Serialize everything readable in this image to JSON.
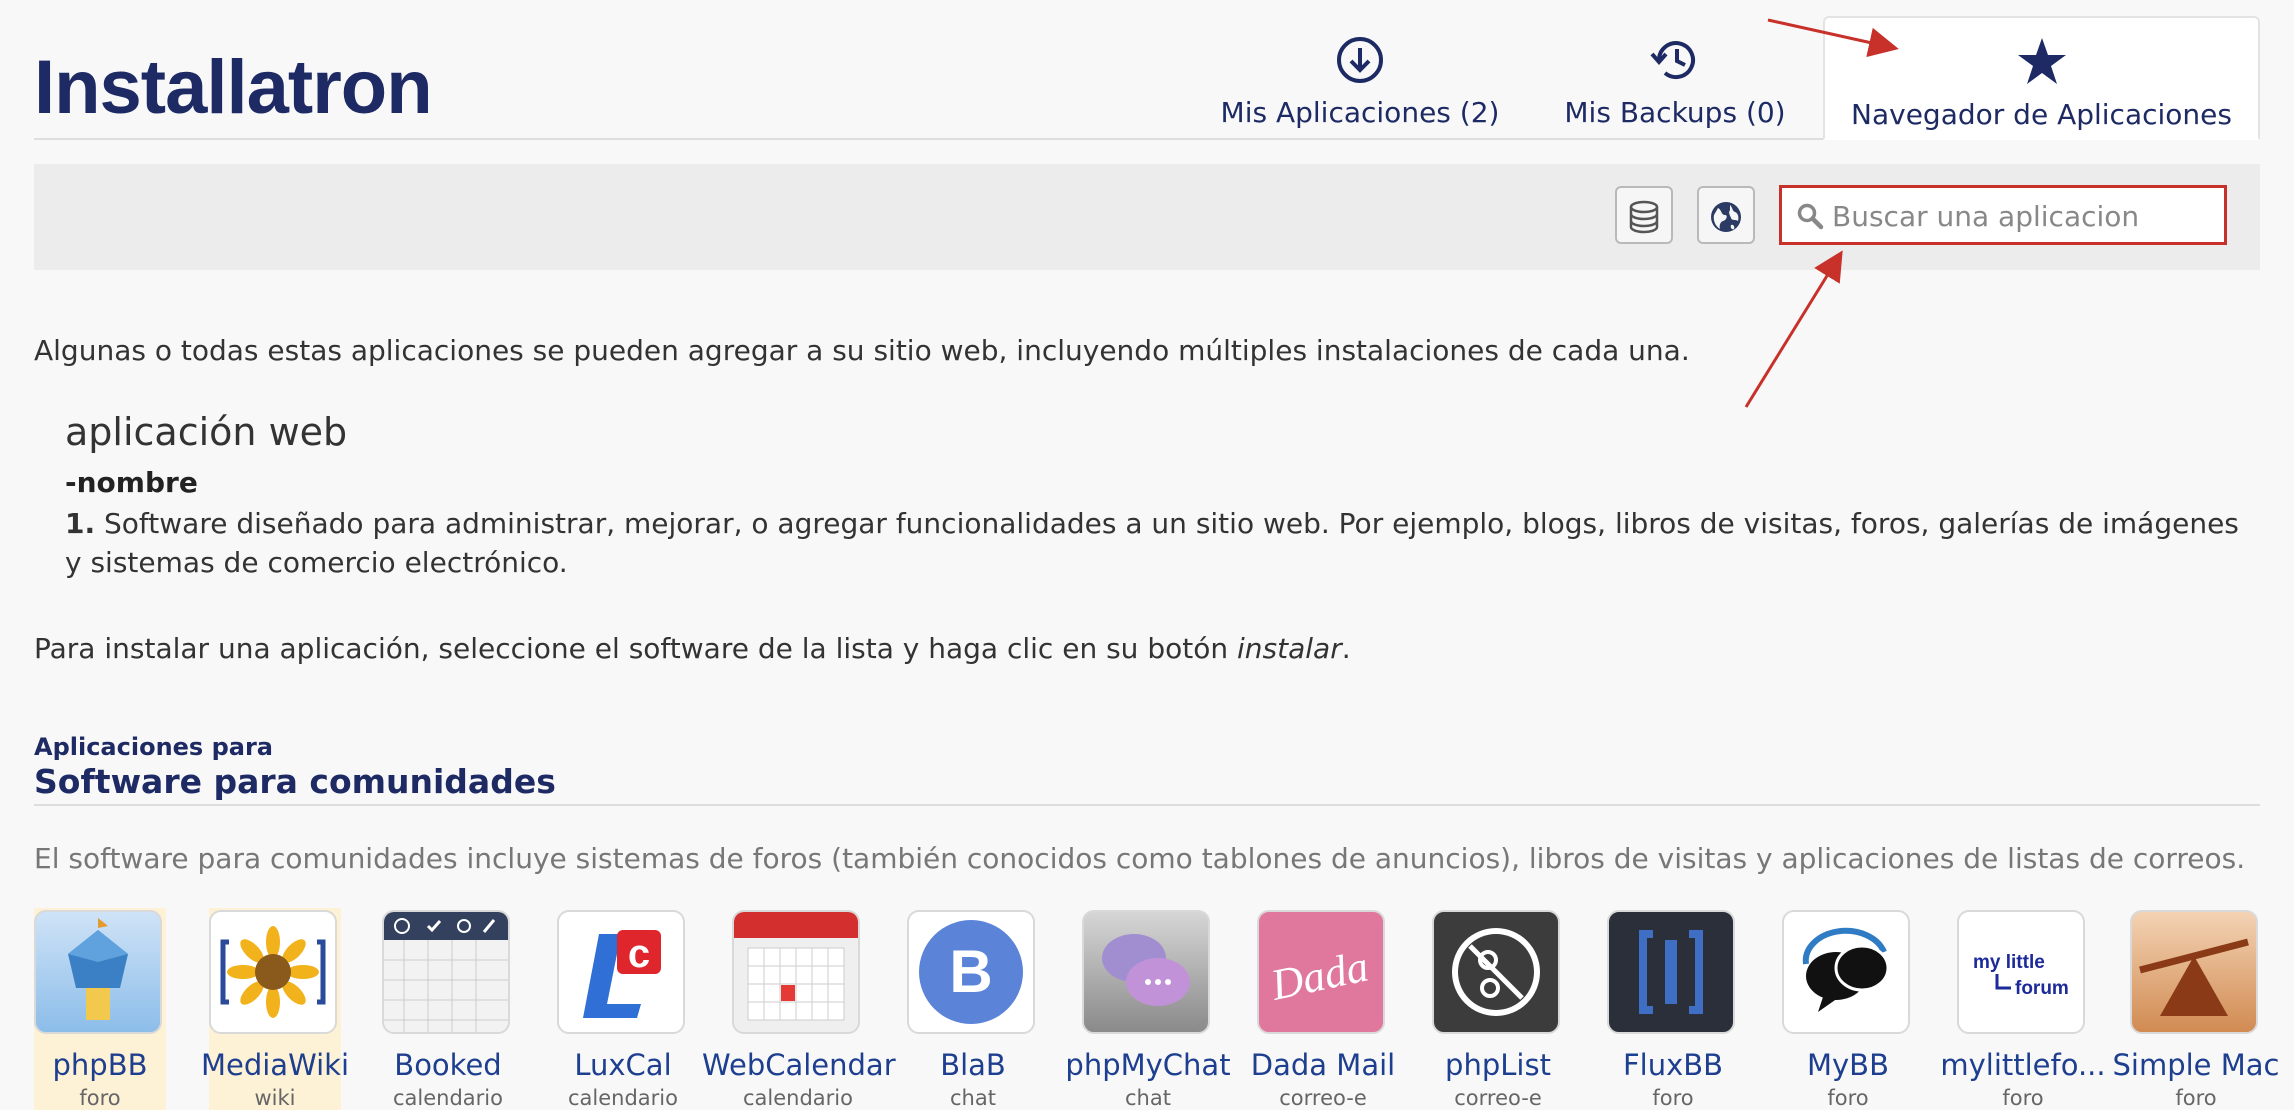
{
  "header": {
    "logo_text": "Installatron",
    "tabs": [
      {
        "label": "Mis Aplicaciones (2)",
        "icon": "download-circle-icon"
      },
      {
        "label": "Mis Backups (0)",
        "icon": "history-icon"
      },
      {
        "label": "Navegador de Aplicaciones",
        "icon": "star-icon"
      }
    ]
  },
  "toolbar": {
    "database_icon": "database-icon",
    "globe_icon": "globe-icon",
    "search_placeholder": "Buscar una aplicacion"
  },
  "intro": "Algunas o todas estas aplicaciones se pueden agregar a su sitio web, incluyendo múltiples instalaciones de cada una.",
  "definition": {
    "term": "aplicación web",
    "part": "-nombre",
    "number": "1.",
    "text": "Software diseñado para administrar, mejorar, o agregar funcionalidades a un sitio web. Por ejemplo, blogs, libros de visitas, foros, galerías de imágenes y sistemas de comercio electrónico."
  },
  "install_note": {
    "prefix": "Para instalar una aplicación, seleccione el software de la lista y haga clic en su botón ",
    "emphasis": "instalar",
    "suffix": "."
  },
  "section": {
    "small_title": "Aplicaciones para",
    "title": "Software para comunidades",
    "description": "El software para comunidades incluye sistemas de foros (también conocidos como tablones de anuncios), libros de visitas y aplicaciones de listas de correos."
  },
  "apps": [
    {
      "name": "phpBB",
      "category": "foro"
    },
    {
      "name": "MediaWiki",
      "category": "wiki"
    },
    {
      "name": "Booked",
      "category": "calendario"
    },
    {
      "name": "LuxCal",
      "category": "calendario"
    },
    {
      "name": "WebCalendar",
      "category": "calendario"
    },
    {
      "name": "BlaB",
      "category": "chat"
    },
    {
      "name": "phpMyChat",
      "category": "chat"
    },
    {
      "name": "Dada Mail",
      "category": "correo-e"
    },
    {
      "name": "phpList",
      "category": "correo-e"
    },
    {
      "name": "FluxBB",
      "category": "foro"
    },
    {
      "name": "MyBB",
      "category": "foro"
    },
    {
      "name": "mylittlefo...",
      "category": "foro"
    },
    {
      "name": "Simple Mac",
      "category": "foro"
    }
  ],
  "app_icon_text": {
    "luxcal": "LC",
    "blab": "B",
    "dada": "Dada",
    "mylittleforum_line1": "my little",
    "mylittleforum_line2": "forum"
  },
  "colors": {
    "brand": "#1e2a64",
    "link": "#1e3f8f",
    "highlight": "#c8302a",
    "highlight_bg": "#fdf1d6"
  }
}
